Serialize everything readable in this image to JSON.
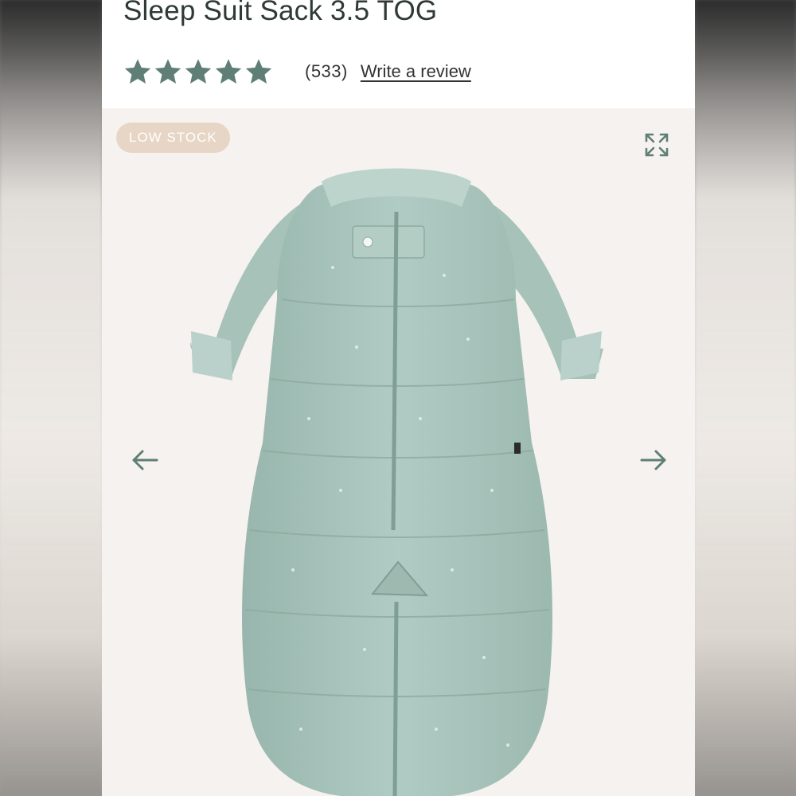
{
  "product": {
    "title": "Sleep Suit Sack 3.5 TOG",
    "rating": 5,
    "rating_max": 5,
    "review_count": "(533)",
    "write_review": "Write a review"
  },
  "gallery": {
    "badge": "LOW STOCK",
    "image_icon": "sleep-suit-sack-image",
    "expand_icon": "expand-icon",
    "prev_icon": "arrow-left-icon",
    "next_icon": "arrow-right-icon"
  },
  "colors": {
    "title": "#2f3a37",
    "stars": "#5f7f76",
    "badge_bg": "#e7d6c5",
    "gallery_bg": "#f6f2ef",
    "product": "#a9c5bd",
    "icons": "#5f7f76"
  }
}
